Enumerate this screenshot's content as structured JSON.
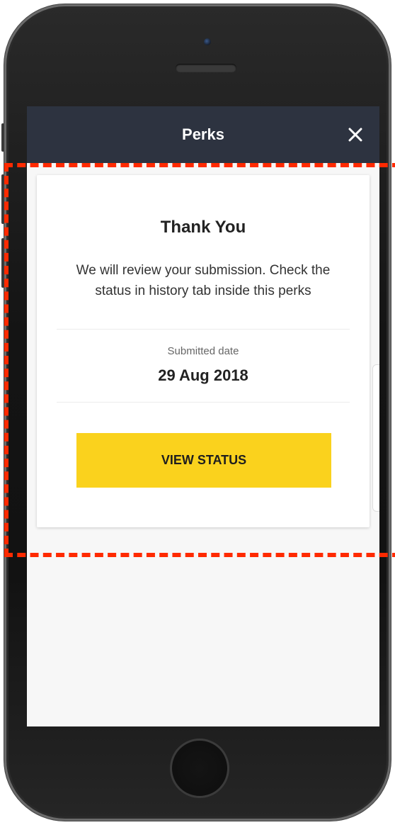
{
  "header": {
    "title": "Perks"
  },
  "card": {
    "title": "Thank You",
    "message": "We will review your submission. Check the status in history tab inside this perks",
    "date_label": "Submitted date",
    "date_value": "29 Aug 2018",
    "button_label": "VIEW STATUS"
  },
  "colors": {
    "header_bg": "#2d3340",
    "button_bg": "#fad21d",
    "highlight": "#ff2a00"
  },
  "icons": {
    "close": "close-icon"
  }
}
